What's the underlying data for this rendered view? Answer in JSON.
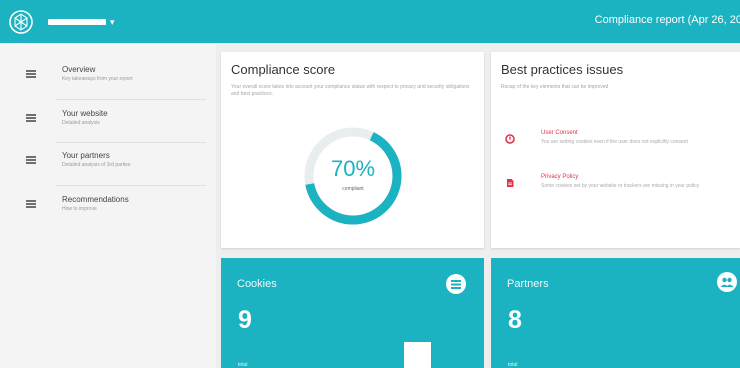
{
  "header": {
    "report_title": "Compliance report (Apr 26, 20",
    "logo_icon": "logo-icon",
    "site_caret": "▾"
  },
  "sidebar": {
    "items": [
      {
        "title": "Overview",
        "subtitle": "Key takeaways from your report",
        "icon": "list-icon"
      },
      {
        "title": "Your website",
        "subtitle": "Detailed analysis",
        "icon": "list-icon"
      },
      {
        "title": "Your partners",
        "subtitle": "Detailed analysis of 3rd parties",
        "icon": "list-icon"
      },
      {
        "title": "Recommendations",
        "subtitle": "How to improve",
        "icon": "list-icon"
      }
    ]
  },
  "compliance": {
    "title": "Compliance score",
    "description": "Your overall score takes into account your compliance status with respect to privacy and security obligations and best practices.",
    "percent_text": "70%",
    "percent_value": 70,
    "status": "compliant"
  },
  "best_practices": {
    "title": "Best practices issues",
    "description": "Recap of the key elements that can be improved",
    "issues": [
      {
        "title": "User Consent",
        "description": "You are setting cookies even if the user does not explicitly consent",
        "icon": "warning-icon"
      },
      {
        "title": "Privacy Policy",
        "description": "Some cookies set by your website or trackers are missing in your policy",
        "icon": "document-icon"
      }
    ]
  },
  "stats": {
    "cookies": {
      "label": "Cookies",
      "value": "9",
      "footer": "total",
      "icon": "list-circle-icon"
    },
    "partners": {
      "label": "Partners",
      "value": "8",
      "footer": "total",
      "icon": "users-icon"
    }
  },
  "colors": {
    "accent": "#1bb2c2",
    "alert": "#e0344a"
  }
}
